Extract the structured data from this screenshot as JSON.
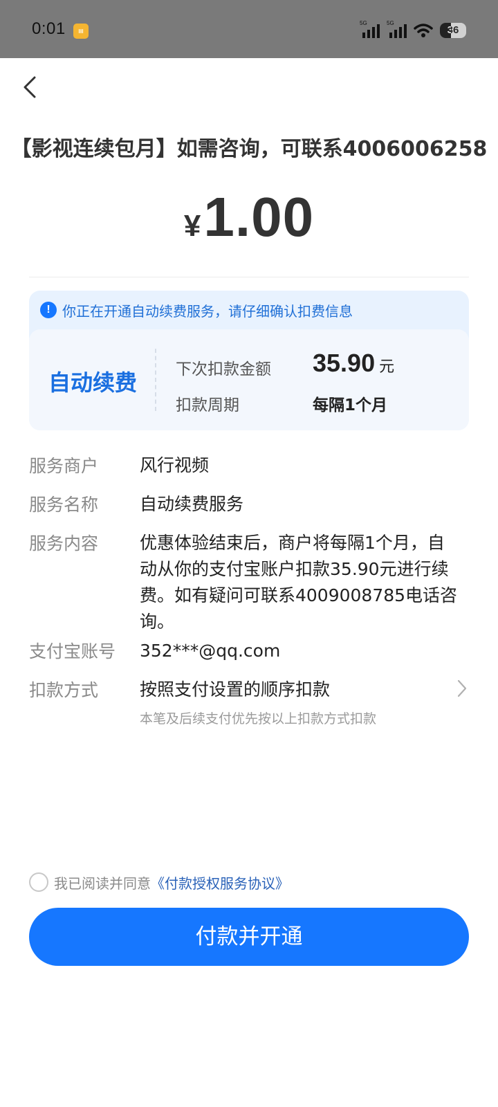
{
  "status_bar": {
    "time": "0:01",
    "network_1": "5G",
    "network_2": "5G",
    "battery": "36"
  },
  "header": {
    "title": "【影视连续包月】如需咨询，可联系4006006258"
  },
  "price": {
    "currency": "¥",
    "amount": "1.00"
  },
  "notice": {
    "text": "你正在开通自动续费服务，请仔细确认扣费信息",
    "auto_label": "自动续费",
    "next_amount_label": "下次扣款金额",
    "next_amount_value": "35.90",
    "next_amount_unit": "元",
    "period_label": "扣款周期",
    "period_value": "每隔1个月"
  },
  "details": {
    "merchant_label": "服务商户",
    "merchant_value": "风行视频",
    "service_name_label": "服务名称",
    "service_name_value": "自动续费服务",
    "content_label": "服务内容",
    "content_value": "优惠体验结束后，商户将每隔1个月，自动从你的支付宝账户扣款35.90元进行续费。如有疑问可联系4009008785电话咨询。",
    "account_label": "支付宝账号",
    "account_value": "352***@qq.com",
    "method_label": "扣款方式",
    "method_value": "按照支付设置的顺序扣款",
    "method_note": "本笔及后续支付优先按以上扣款方式扣款"
  },
  "agreement": {
    "text": "我已阅读并同意",
    "link": "《付款授权服务协议》"
  },
  "actions": {
    "pay_label": "付款并开通"
  },
  "colors": {
    "primary": "#1677ff",
    "notice_bg": "#e8f2fe",
    "link": "#2a62b8"
  }
}
